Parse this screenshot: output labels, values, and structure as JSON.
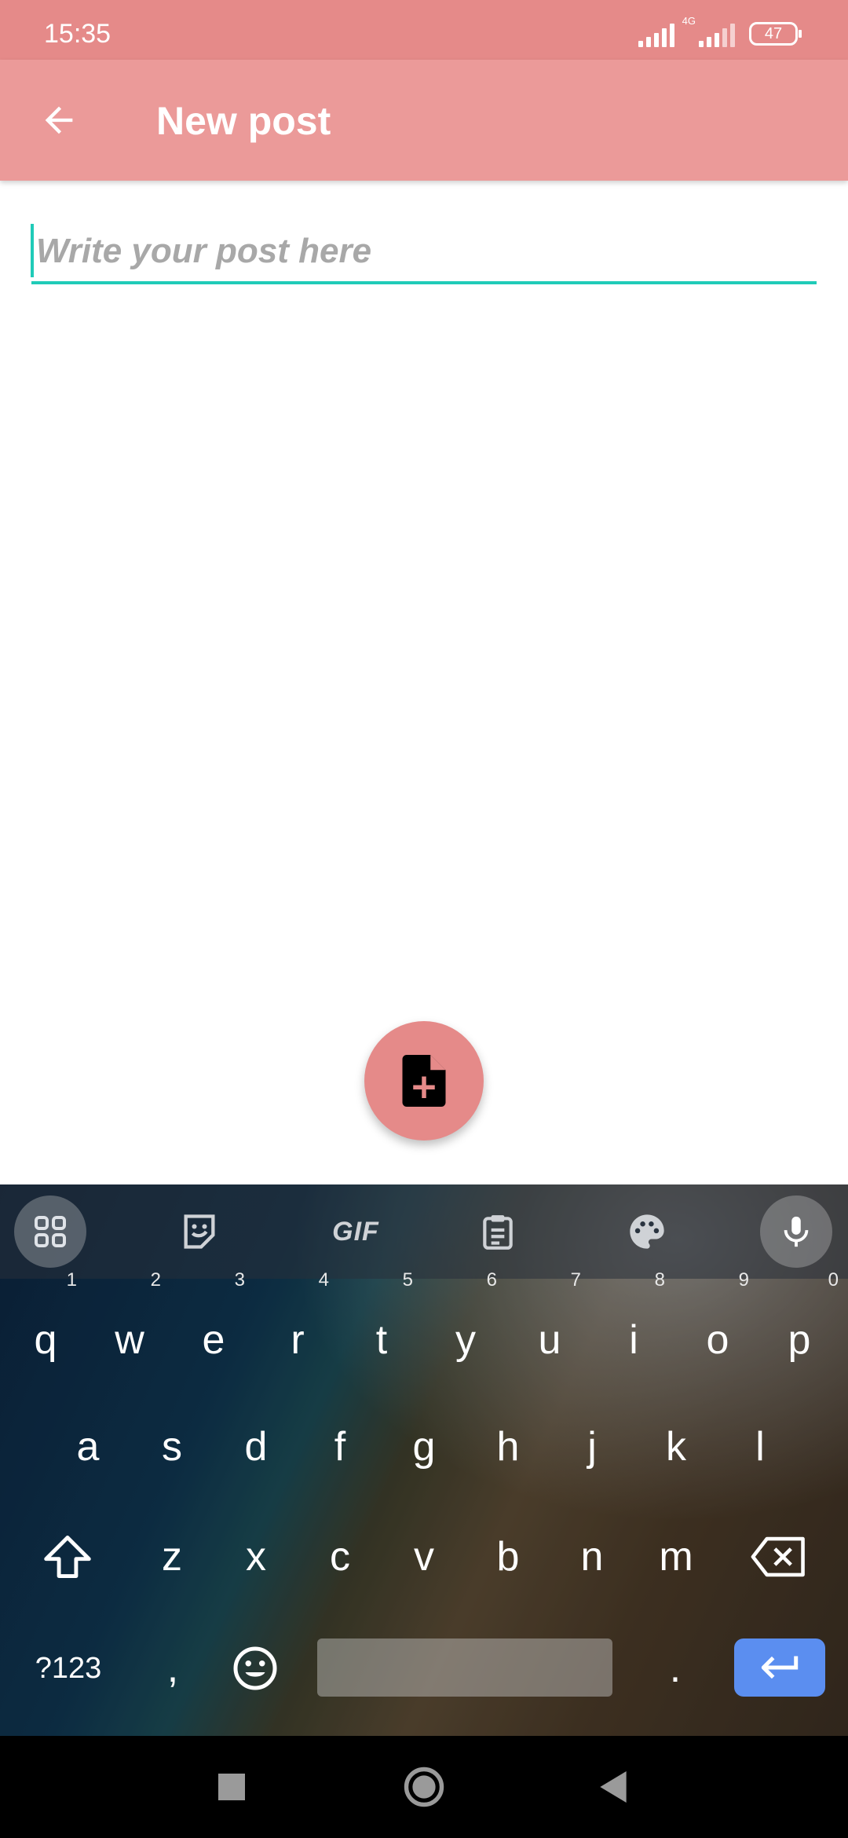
{
  "status_bar": {
    "time": "15:35",
    "network": "4G",
    "battery": "47"
  },
  "app_bar": {
    "back_icon": "arrow-left-icon",
    "title": "New post"
  },
  "post_input": {
    "placeholder": "Write your post here",
    "value": ""
  },
  "fab": {
    "icon": "file-plus-icon"
  },
  "keyboard": {
    "toolbar": {
      "apps_icon": "grid-icon",
      "sticker_icon": "sticker-icon",
      "gif_label": "GIF",
      "clipboard_icon": "clipboard-icon",
      "theme_icon": "palette-icon",
      "mic_icon": "microphone-icon"
    },
    "row1": [
      {
        "k": "q",
        "h": "1"
      },
      {
        "k": "w",
        "h": "2"
      },
      {
        "k": "e",
        "h": "3"
      },
      {
        "k": "r",
        "h": "4"
      },
      {
        "k": "t",
        "h": "5"
      },
      {
        "k": "y",
        "h": "6"
      },
      {
        "k": "u",
        "h": "7"
      },
      {
        "k": "i",
        "h": "8"
      },
      {
        "k": "o",
        "h": "9"
      },
      {
        "k": "p",
        "h": "0"
      }
    ],
    "row2": [
      "a",
      "s",
      "d",
      "f",
      "g",
      "h",
      "j",
      "k",
      "l"
    ],
    "row3": [
      "z",
      "x",
      "c",
      "v",
      "b",
      "n",
      "m"
    ],
    "symbols_label": "?123",
    "comma_label": ",",
    "period_label": ".",
    "emoji_icon": "emoji-icon",
    "enter_icon": "enter-icon",
    "shift_icon": "shift-icon",
    "backspace_icon": "backspace-icon"
  },
  "nav": {
    "recents_icon": "square-icon",
    "home_icon": "circle-icon",
    "back_icon": "triangle-back-icon"
  },
  "colors": {
    "status_bar": "#e58a89",
    "app_bar": "#eb9a99",
    "accent": "#20cbb8",
    "fab": "#e58a89",
    "enter_key": "#5b8ef0"
  }
}
